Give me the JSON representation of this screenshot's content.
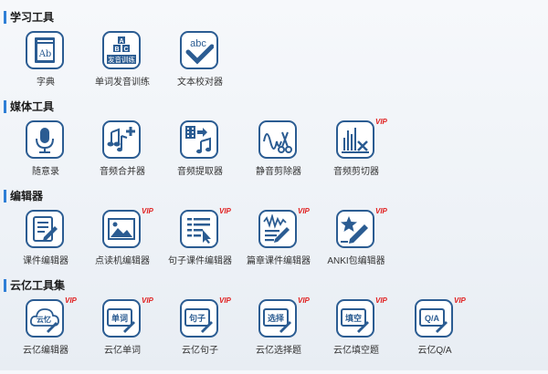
{
  "sections": [
    {
      "title": "学习工具",
      "tools": [
        {
          "label": "字典",
          "icon": "dictionary-book-icon",
          "vip": ""
        },
        {
          "label": "单词发音训练",
          "icon": "word-pronunciation-blocks-icon",
          "vip": "",
          "text": [
            "A",
            "B",
            "C",
            "发音训练"
          ]
        },
        {
          "label": "文本校对器",
          "icon": "text-proofread-check-icon",
          "vip": "",
          "text": [
            "abc"
          ]
        }
      ]
    },
    {
      "title": "媒体工具",
      "tools": [
        {
          "label": "随意录",
          "icon": "microphone-icon",
          "vip": ""
        },
        {
          "label": "音频合并器",
          "icon": "audio-merge-notes-icon",
          "vip": ""
        },
        {
          "label": "音频提取器",
          "icon": "audio-extract-film-icon",
          "vip": ""
        },
        {
          "label": "静音剪除器",
          "icon": "silence-cut-scissors-icon",
          "vip": ""
        },
        {
          "label": "音频剪切器",
          "icon": "audio-cut-bars-icon",
          "vip": "VIP"
        }
      ]
    },
    {
      "title": "编辑器",
      "tools": [
        {
          "label": "课件编辑器",
          "icon": "courseware-edit-icon",
          "vip": ""
        },
        {
          "label": "点读机编辑器",
          "icon": "picture-reader-edit-icon",
          "vip": "VIP"
        },
        {
          "label": "句子课件编辑器",
          "icon": "sentence-courseware-cursor-icon",
          "vip": "VIP"
        },
        {
          "label": "篇章课件编辑器",
          "icon": "passage-courseware-wave-icon",
          "vip": "VIP"
        },
        {
          "label": "ANKI包编辑器",
          "icon": "anki-star-pencil-icon",
          "vip": "VIP"
        }
      ]
    },
    {
      "title": "云亿工具集",
      "tools": [
        {
          "label": "云亿编辑器",
          "icon": "yunyi-cloud-editor-icon",
          "vip": "VIP",
          "text": [
            "云忆"
          ]
        },
        {
          "label": "云亿单词",
          "icon": "yunyi-word-icon",
          "vip": "VIP",
          "text": [
            "单词"
          ]
        },
        {
          "label": "云亿句子",
          "icon": "yunyi-sentence-icon",
          "vip": "VIP",
          "text": [
            "句子"
          ]
        },
        {
          "label": "云亿选择题",
          "icon": "yunyi-choice-icon",
          "vip": "VIP",
          "text": [
            "选择"
          ]
        },
        {
          "label": "云亿填空题",
          "icon": "yunyi-fill-blank-icon",
          "vip": "VIP",
          "text": [
            "填空"
          ]
        },
        {
          "label": "云亿Q/A",
          "icon": "yunyi-qa-icon",
          "vip": "VIP",
          "text": [
            "Q/A"
          ]
        }
      ]
    }
  ],
  "colors": {
    "icon": "#2b5c92",
    "accent": "#2f7fd6",
    "vip": "#e02020"
  }
}
